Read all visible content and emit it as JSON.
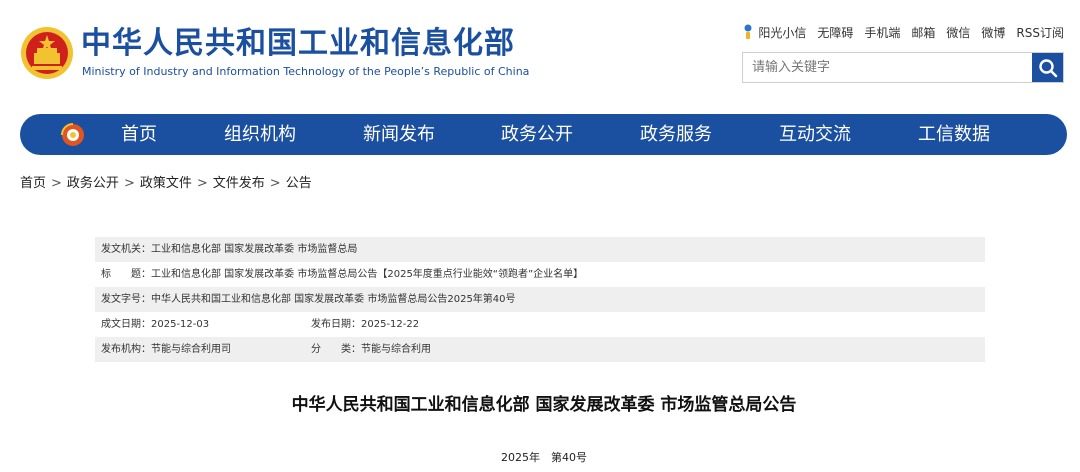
{
  "header": {
    "site_title": "中华人民共和国工业和信息化部",
    "site_subtitle": "Ministry of Industry and Information Technology of the People’s Republic of China",
    "emblem_icon": "national-emblem-icon",
    "top_links": [
      "阳光小信",
      "无障碍",
      "手机端",
      "邮箱",
      "微信",
      "微博",
      "RSS订阅"
    ],
    "search": {
      "placeholder": "请输入关键字",
      "icon": "search-icon"
    }
  },
  "nav": {
    "items": [
      "首页",
      "组织机构",
      "新闻发布",
      "政务公开",
      "政务服务",
      "互动交流",
      "工信数据"
    ],
    "logo_icon": "ministry-logo-icon"
  },
  "breadcrumb": [
    "首页",
    "政务公开",
    "政策文件",
    "文件发布",
    "公告"
  ],
  "meta": {
    "issuer": "发文机关：工业和信息化部 国家发展改革委 市场监督总局",
    "title": "标　　题：工业和信息化部 国家发展改革委 市场监督总局公告【2025年度重点行业能效“领跑者”企业名单】",
    "doc_number": "发文字号：中华人民共和国工业和信息化部 国家发展改革委 市场监督总局公告2025年第40号",
    "created": "成文日期：2025-12-03",
    "published": "发布日期：2025-12-22",
    "agency": "发布机构：节能与综合利用司",
    "category": "分　　类：节能与综合利用"
  },
  "announcement": {
    "title": "中华人民共和国工业和信息化部 国家发展改革委 市场监管总局公告",
    "number": "2025年　第40号"
  },
  "colors": {
    "brand_blue": "#1b4fa0",
    "meta_row_gray": "#efefef",
    "emblem_red": "#d0201b",
    "emblem_gold": "#f2c230"
  }
}
